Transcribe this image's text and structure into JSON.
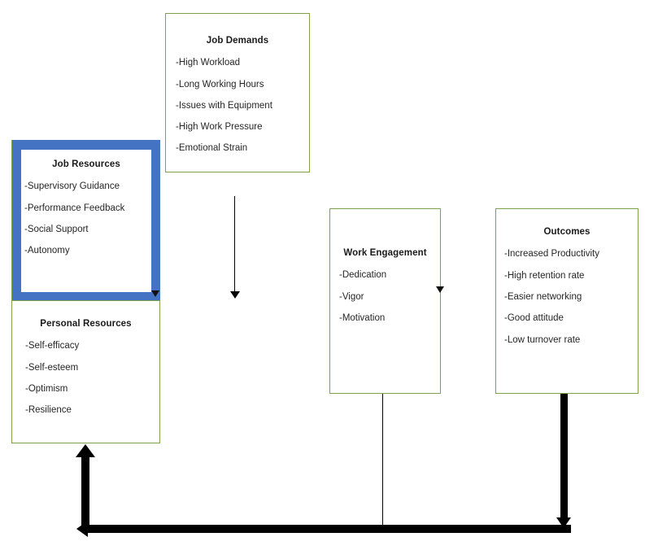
{
  "diagram": {
    "title_hidden": "Job Demands-Resources Model",
    "colors": {
      "box_border_green": "#7fa14a",
      "resource_frame_blue": "#4573c4",
      "arrow_black": "#000000",
      "text": "#262626",
      "background": "#ffffff"
    }
  },
  "boxes": {
    "job_demands": {
      "title": "Job Demands",
      "items": [
        "-High Workload",
        "-Long Working Hours",
        "-Issues with Equipment",
        "-High Work Pressure",
        "-Emotional Strain"
      ]
    },
    "job_resources": {
      "title": "Job Resources",
      "items": [
        "-Supervisory Guidance",
        "-Performance Feedback",
        "-Social Support",
        "-Autonomy"
      ]
    },
    "personal_resources": {
      "title": "Personal Resources",
      "items": [
        "-Self-efficacy",
        "-Self-esteem",
        "-Optimism",
        "-Resilience"
      ]
    },
    "work_engagement": {
      "title": "Work Engagement",
      "items": [
        "-Dedication",
        "-Vigor",
        "-Motivation"
      ]
    },
    "outcomes": {
      "title": "Outcomes",
      "items": [
        "-Increased Productivity",
        "-High retention rate",
        "-Easier networking",
        "-Good attitude",
        "-Low turnover rate"
      ]
    }
  },
  "connectors": {
    "job_demands_down": "arrow-down-from-job-demands",
    "job_resources_to_personal_resources": "blue-frame-arrow-down",
    "work_engagement_down": "arrow-down-right-of-work-engagement",
    "work_engagement_to_bottom": "line-down-to-feedback-bar",
    "outcomes_to_bottom": "thick-line-down-to-feedback-bar",
    "feedback_bar": "thick-feedback-arrow-to-resources"
  }
}
